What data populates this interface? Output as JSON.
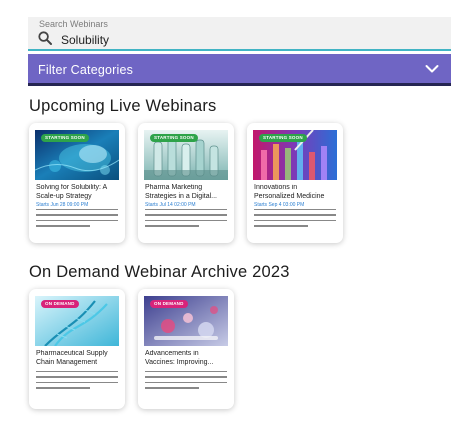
{
  "search": {
    "label": "Search Webinars",
    "value": "Solubility",
    "icon": "search-icon"
  },
  "filter": {
    "label": "Filter Categories",
    "icon": "chevron-down-icon",
    "color": "#6f65c4"
  },
  "upcoming": {
    "title": "Upcoming Live Webinars",
    "cards": [
      {
        "badge": "STARTING SOON",
        "title": "Solving for Solubility: A Scale-up Strategy",
        "date": "Starts Jun 28 09:00 PM"
      },
      {
        "badge": "STARTING SOON",
        "title": "Pharma Marketing Strategies in a Digital...",
        "date": "Starts Jul 14 02:00 PM"
      },
      {
        "badge": "STARTING SOON",
        "title": "Innovations in Personalized Medicine",
        "date": "Starts Sep 4 03:00 PM"
      }
    ]
  },
  "on_demand": {
    "title": "On Demand Webinar Archive 2023",
    "cards": [
      {
        "badge": "ON DEMAND",
        "title": "Pharmaceutical Supply Chain Management"
      },
      {
        "badge": "ON DEMAND",
        "title": "Advancements in Vaccines: Improving..."
      }
    ]
  },
  "colors": {
    "starting_soon_badge": "#2ea34a",
    "on_demand_badge": "#d8237a",
    "date_text": "#2c7fd1",
    "search_underline": "#41b4c4"
  }
}
